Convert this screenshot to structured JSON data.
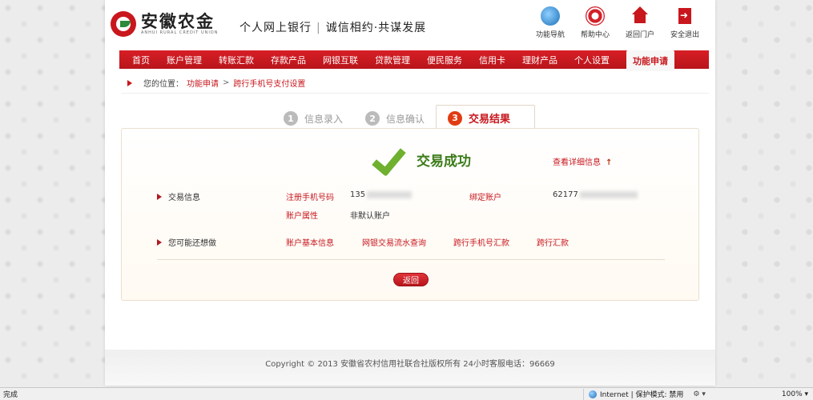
{
  "header": {
    "logo_cn": "安徽农金",
    "logo_en": "ANHUI RURAL CREDIT UNION",
    "slogan_main": "个人网上银行",
    "slogan_sep": "|",
    "slogan_sub": "诚信相约·共谋发展",
    "top_links": [
      "功能导航",
      "帮助中心",
      "返回门户",
      "安全退出"
    ]
  },
  "nav": {
    "items": [
      "首页",
      "账户管理",
      "转账汇款",
      "存款产品",
      "网银互联",
      "贷款管理",
      "便民服务",
      "信用卡",
      "理财产品",
      "个人设置"
    ],
    "active": "功能申请"
  },
  "breadcrumb": {
    "label": "您的位置：",
    "path": [
      "功能申请",
      "跨行手机号支付设置"
    ],
    "sep": ">"
  },
  "steps": [
    {
      "num": "1",
      "label": "信息录入"
    },
    {
      "num": "2",
      "label": "信息确认"
    },
    {
      "num": "3",
      "label": "交易结果"
    }
  ],
  "result": {
    "status": "交易成功",
    "detail_link": "查看详细信息",
    "detail_arrow": "↑"
  },
  "info": {
    "section_title": "交易信息",
    "phone_label": "注册手机号码",
    "phone_value": "135",
    "account_label": "绑定账户",
    "account_value": "62177",
    "attr_label": "账户属性",
    "attr_value": "非默认账户"
  },
  "more": {
    "section_title": "您可能还想做",
    "links": [
      "账户基本信息",
      "网银交易流水查询",
      "跨行手机号汇款",
      "跨行汇款"
    ]
  },
  "return_button": "返回",
  "footer": {
    "copyright": "Copyright © 2013   安徽省农村信用社联合社版权所有   24小时客服电话：96669"
  },
  "statusbar": {
    "left": "完成",
    "zone": "Internet | 保护模式: 禁用",
    "tools": "⚙ ▾",
    "zoom": "100% ▾"
  }
}
